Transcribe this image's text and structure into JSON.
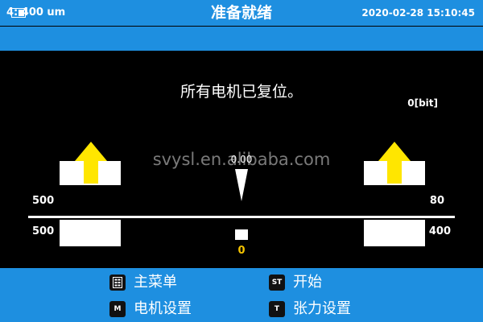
{
  "header": {
    "title": "准备就绪",
    "datetime": "2020-02-28 15:10:45",
    "battery_icon": "battery-icon"
  },
  "subheader": {
    "step_info": "4: 400 um"
  },
  "main": {
    "message": "所有电机已复位。",
    "bit_readout": "0[bit]",
    "center_value": "0.00",
    "left_upper_value": "500",
    "right_upper_value": "80",
    "left_lower_value": "500",
    "right_lower_value": "400",
    "center_zero": "0",
    "watermark": "svysl.en.alibaba.com",
    "arrow_color": "#ffe600",
    "zero_color": "#f5c400"
  },
  "footer": {
    "main_menu_key_icon": "menu-key-icon",
    "main_menu_label": "主菜单",
    "start_key": "ST",
    "start_label": "开始",
    "motor_key": "M",
    "motor_label": "电机设置",
    "tension_key": "T",
    "tension_label": "张力设置"
  },
  "colors": {
    "bar": "#1e8fe0",
    "background": "#000000"
  }
}
